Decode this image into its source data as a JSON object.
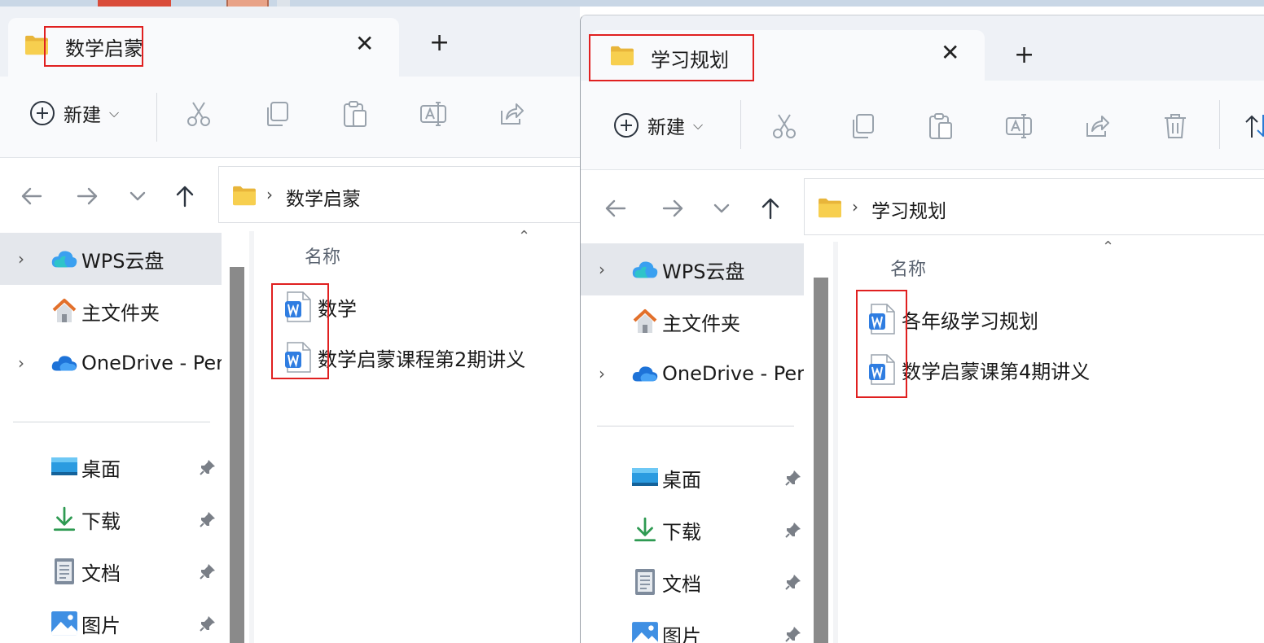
{
  "accent_colors": {
    "highlight": "#e02020",
    "selected_nav": "#e4e7ec",
    "wps_blue": "#2f7de1"
  },
  "windows": [
    {
      "tab_title": "数学启蒙",
      "new_label": "新建",
      "breadcrumb": "数学启蒙",
      "column_name": "名称",
      "files": [
        "数学",
        "数学启蒙课程第2期讲义"
      ],
      "nav": {
        "wps": "WPS云盘",
        "home": "主文件夹",
        "onedrive": "OneDrive - Pers",
        "desktop": "桌面",
        "downloads": "下载",
        "documents": "文档",
        "pictures": "图片"
      }
    },
    {
      "tab_title": "学习规划",
      "new_label": "新建",
      "breadcrumb": "学习规划",
      "column_name": "名称",
      "files": [
        "各年级学习规划",
        "数学启蒙课第4期讲义"
      ],
      "nav": {
        "wps": "WPS云盘",
        "home": "主文件夹",
        "onedrive": "OneDrive - Pers",
        "desktop": "桌面",
        "downloads": "下载",
        "documents": "文档",
        "pictures": "图片"
      }
    }
  ]
}
